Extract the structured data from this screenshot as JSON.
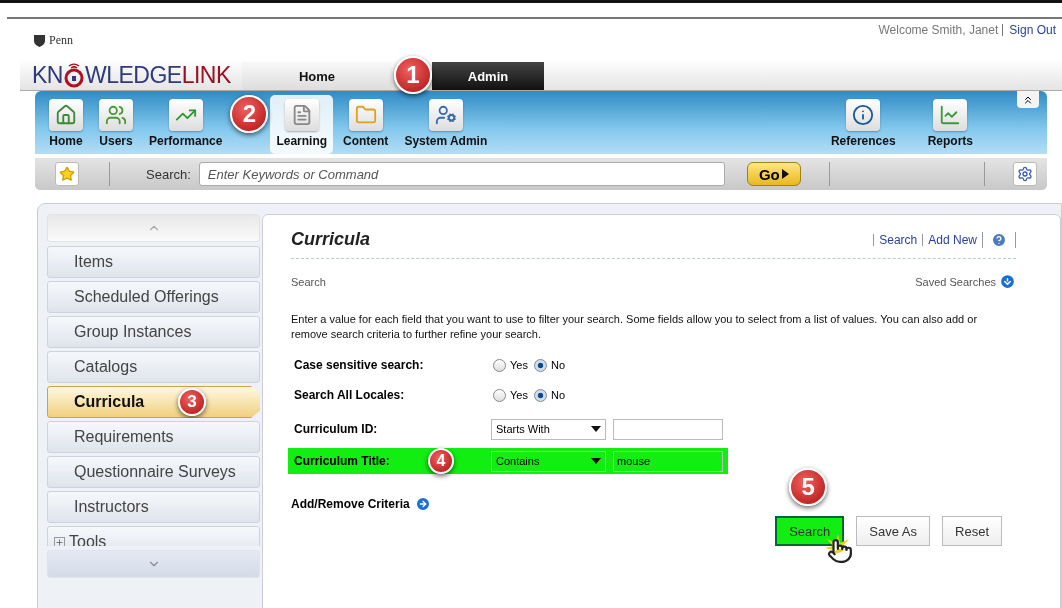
{
  "header": {
    "university": "Penn",
    "logo_start": "KN",
    "logo_middle": "WLEDGE",
    "logo_end": "LINK",
    "welcome": "Welcome Smith, Janet",
    "sign_out": "Sign Out"
  },
  "top_tabs": [
    {
      "label": "Home",
      "selected": false
    },
    {
      "label": "Admin",
      "selected": true,
      "callout": "1"
    }
  ],
  "toolbar": {
    "items": [
      {
        "label": "Home",
        "kind": "home",
        "selected": false
      },
      {
        "label": "Users",
        "kind": "users",
        "selected": false
      },
      {
        "label": "Performance",
        "kind": "performance",
        "selected": false
      },
      {
        "label": "Learning",
        "kind": "learning",
        "selected": true,
        "callout": "2"
      },
      {
        "label": "Content",
        "kind": "content",
        "selected": false
      },
      {
        "label": "System Admin",
        "kind": "admin",
        "selected": false
      }
    ],
    "right_items": [
      {
        "label": "References",
        "kind": "info",
        "selected": false
      },
      {
        "label": "Reports",
        "kind": "reports",
        "selected": false
      }
    ]
  },
  "search_bar": {
    "label": "Search:",
    "placeholder": "Enter Keywords or Command",
    "go": "Go"
  },
  "sidebar": {
    "items": [
      {
        "label": "Items",
        "kind": "link",
        "selected": false
      },
      {
        "label": "Scheduled Offerings",
        "kind": "link",
        "selected": false
      },
      {
        "label": "Group Instances",
        "kind": "link",
        "selected": false
      },
      {
        "label": "Catalogs",
        "kind": "link",
        "selected": false
      },
      {
        "label": "Curricula",
        "kind": "link",
        "selected": true,
        "callout": "3"
      },
      {
        "label": "Requirements",
        "kind": "link",
        "selected": false
      },
      {
        "label": "Questionnaire Surveys",
        "kind": "link",
        "selected": false
      },
      {
        "label": "Instructors",
        "kind": "link",
        "selected": false
      },
      {
        "label": "Tools",
        "kind": "expandable",
        "selected": false
      }
    ]
  },
  "panel": {
    "title": "Curricula",
    "links": [
      "Search",
      "Add New"
    ],
    "section": "Search",
    "saved_searches": "Saved Searches",
    "intro": "Enter a value for each field that you want to use to filter your search. Some fields allow you to select from a list of values. You can also add or remove search criteria to further refine your search.",
    "options": [
      {
        "label": "Case sensitive search:",
        "choices": [
          {
            "label": "Yes",
            "selected": false
          },
          {
            "label": "No",
            "selected": true
          }
        ]
      },
      {
        "label": "Search All Locales:",
        "choices": [
          {
            "label": "Yes",
            "selected": false
          },
          {
            "label": "No",
            "selected": true
          }
        ]
      }
    ],
    "criteria": [
      {
        "label": "Curriculum ID:",
        "operator": "Starts With",
        "highlighted": false
      },
      {
        "label": "Curriculum Title:",
        "operator": "Contains",
        "value": "mouse",
        "highlighted": true,
        "callout": "4"
      }
    ],
    "add_remove": "Add/Remove Criteria",
    "buttons": [
      {
        "label": "Search",
        "highlighted": true,
        "callout": "5"
      },
      {
        "label": "Save As",
        "highlighted": false
      },
      {
        "label": "Reset",
        "highlighted": false
      }
    ]
  }
}
